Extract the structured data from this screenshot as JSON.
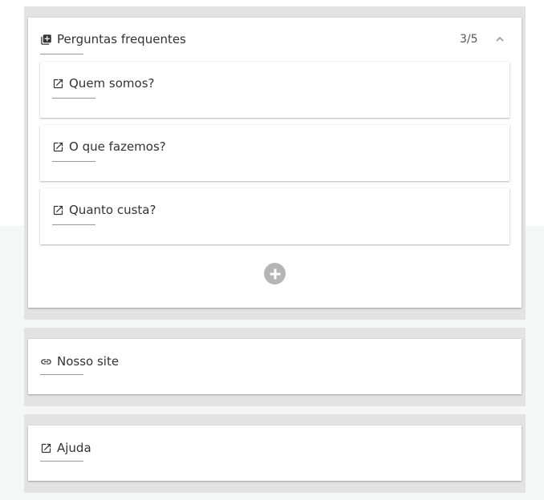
{
  "faq_section": {
    "title": "Perguntas frequentes",
    "title_icon": "library-add-icon",
    "counter": "3/5",
    "collapse_icon": "chevron-up-icon",
    "items": [
      {
        "label": "Quem somos?",
        "icon": "open-in-new-icon"
      },
      {
        "label": "O que fazemos?",
        "icon": "open-in-new-icon"
      },
      {
        "label": "Quanto custa?",
        "icon": "open-in-new-icon"
      }
    ],
    "add_icon": "add-circle-icon"
  },
  "site_section": {
    "title": "Nosso site",
    "icon": "link-icon"
  },
  "help_section": {
    "title": "Ajuda",
    "icon": "open-in-new-icon"
  },
  "colors": {
    "section_background": "#e3e3e3",
    "card_background": "#ffffff",
    "text": "#333333",
    "add_button": "#b5b5b5"
  }
}
